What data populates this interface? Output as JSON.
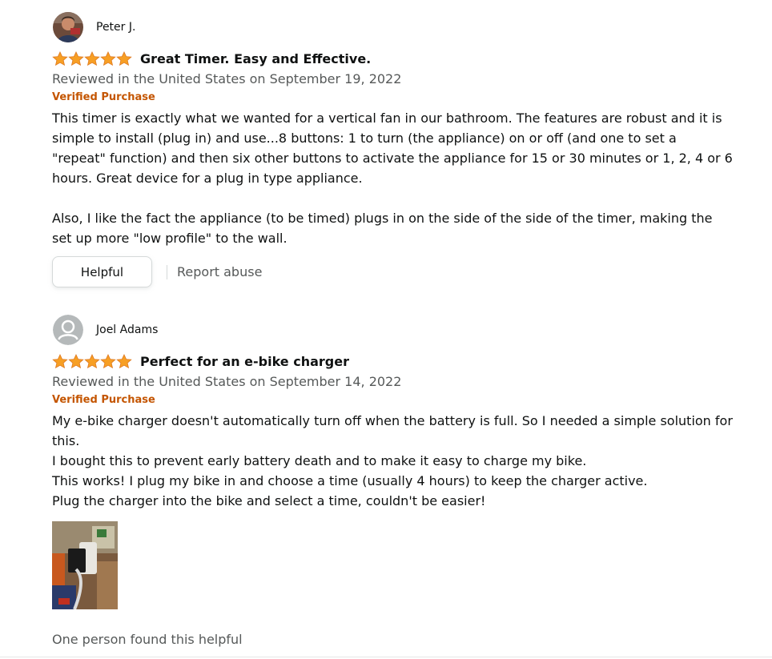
{
  "reviews": [
    {
      "reviewer": "Peter J.",
      "rating": 5,
      "title": "Great Timer. Easy and Effective.",
      "date": "Reviewed in the United States on September 19, 2022",
      "verified": "Verified Purchase",
      "paragraphs": [
        "This timer is exactly what we wanted for a vertical fan in our bathroom. The features are robust and it is simple to install (plug in) and use...8 buttons: 1 to turn (the appliance) on or off (and one to set a \"repeat\" function) and then six other buttons to activate the appliance for 15 or 30 minutes or 1, 2, 4 or 6 hours. Great device for a plug in type appliance.",
        "Also, I like the fact the appliance (to be timed) plugs in on the side of the side of the timer, making the set up more \"low profile\" to the wall."
      ],
      "helpful_label": "Helpful",
      "report_label": "Report abuse"
    },
    {
      "reviewer": "Joel Adams",
      "rating": 5,
      "title": "Perfect for an e-bike charger",
      "date": "Reviewed in the United States on September 14, 2022",
      "verified": "Verified Purchase",
      "lines": [
        "My e-bike charger doesn't automatically turn off when the battery is full. So I needed a simple solution for this.",
        "I bought this to prevent early battery death and to make it easy to charge my bike.",
        "This works! I plug my bike in and choose a time (usually 4 hours) to keep the charger active.",
        "Plug the charger into the bike and select a time, couldn't be easier!"
      ],
      "helpful_count": "One person found this helpful"
    }
  ],
  "colors": {
    "star": "#f79f24",
    "verified": "#c45500",
    "secondary_text": "#565959"
  }
}
